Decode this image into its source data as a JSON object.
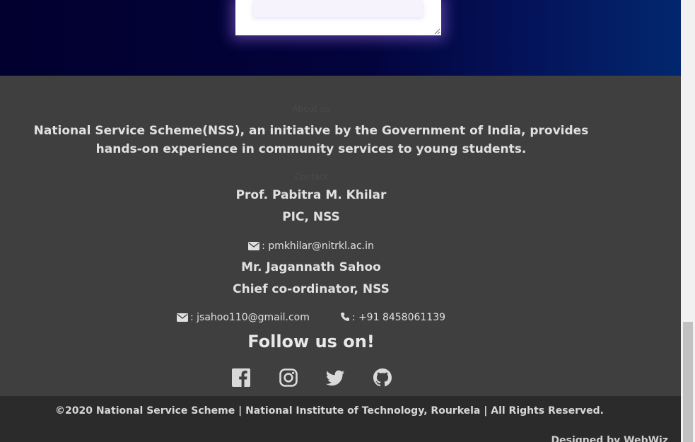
{
  "footer": {
    "about_heading": "About us",
    "about_text": "National Service Scheme(NSS), an initiative by the Government of India, provides hands-on experience in community services to young students.",
    "contact_heading": "Contact",
    "contacts": [
      {
        "name": "Prof. Pabitra M. Khilar",
        "role": "PIC, NSS",
        "email": ": pmkhilar@nitrkl.ac.in"
      },
      {
        "name": "Mr. Jagannath Sahoo",
        "role": "Chief co-ordinator, NSS",
        "email": ": jsahoo110@gmail.com",
        "phone": ": +91 8458061139"
      }
    ],
    "follow_text": "Follow us on!",
    "social": [
      "facebook-icon",
      "instagram-icon",
      "twitter-icon",
      "github-icon"
    ]
  },
  "bottom": {
    "copyright": "©2020 National Service Scheme | National Institute of Technology, Rourkela | All Rights Reserved.",
    "designed_by": "Designed by WebWiz"
  },
  "colors": {
    "hero_start": "#02002e",
    "hero_end": "#02276e",
    "footer_bg": "#3f3f3f",
    "bottom_bar_bg": "#2b2b2b",
    "text": "#e0e0e0"
  }
}
